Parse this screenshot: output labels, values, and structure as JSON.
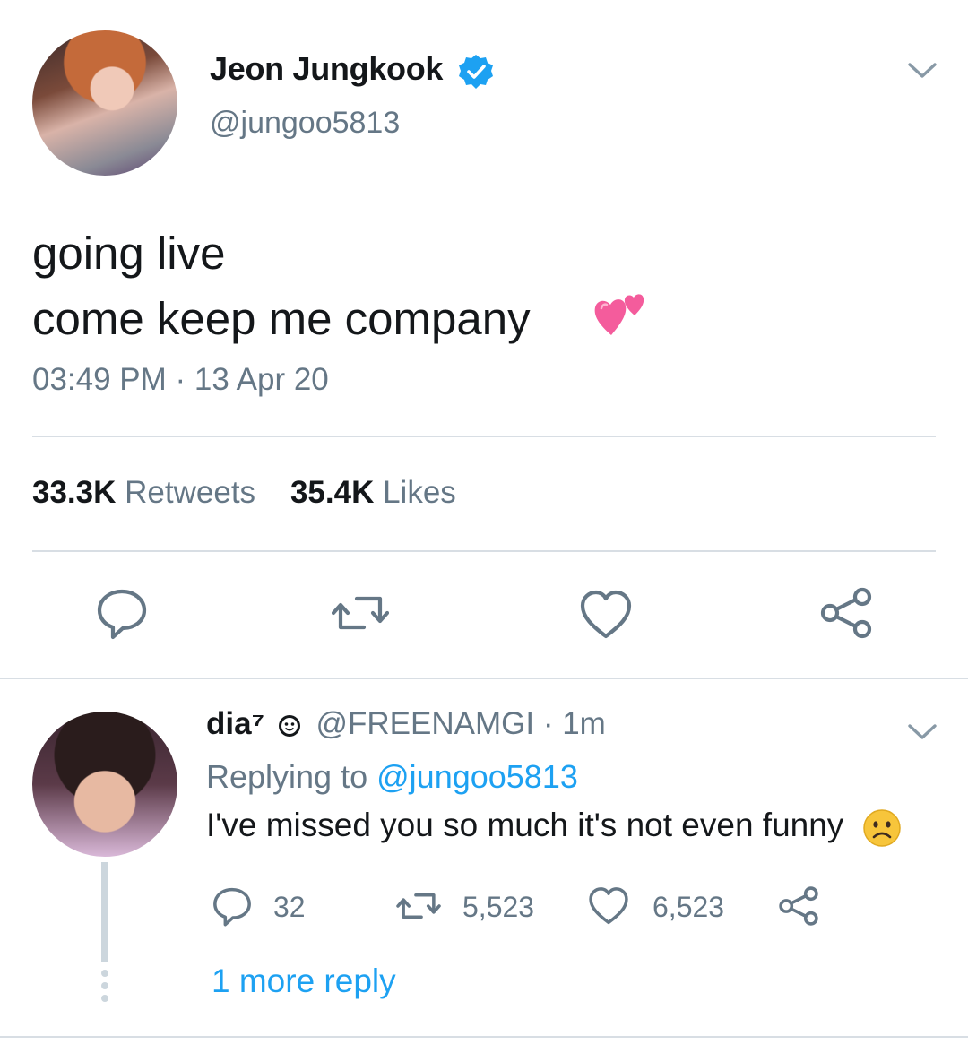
{
  "tweet": {
    "author_name": "Jeon Jungkook",
    "handle": "@jungoo5813",
    "text_line1": "going live",
    "text_line2": "come keep me company",
    "emoji": "💕",
    "timestamp": "03:49 PM · 13 Apr 20",
    "retweets_count": "33.3K",
    "retweets_label": "Retweets",
    "likes_count": "35.4K",
    "likes_label": "Likes"
  },
  "reply": {
    "author_name": "dia⁷",
    "handle": "@FREENAMGI",
    "time": "· 1m",
    "replying_prefix": "Replying to",
    "replying_handle": "@jungoo5813",
    "text": "I've missed you so much it's not even funny",
    "emoji": "☹",
    "replies_count": "32",
    "retweets_count": "5,523",
    "likes_count": "6,523",
    "more_replies": "1 more reply"
  },
  "colors": {
    "accent": "#1da1f2",
    "muted": "#657786",
    "text": "#14171a",
    "divider": "#d8dee4",
    "emoji_pink": "#f45c9c",
    "emoji_yellow": "#f7c53b"
  },
  "icons": [
    "verified-badge-icon",
    "chevron-down-icon",
    "reply-icon",
    "retweet-icon",
    "like-icon",
    "share-icon",
    "face-emoji-icon"
  ]
}
